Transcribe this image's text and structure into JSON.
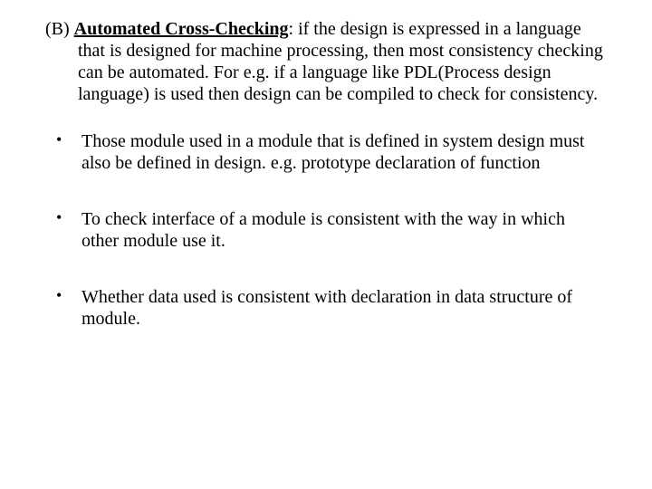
{
  "section": {
    "label": "(B) ",
    "heading": "Automated Cross-Checking",
    "body": ": if the design is expressed in a language that is designed for machine processing, then most consistency checking can be automated. For e.g. if a language like PDL(Process design language) is used then design can be compiled to check for consistency."
  },
  "bullets": [
    {
      "text": "Those module used in a module that is defined in system design must also be defined in design. e.g. prototype declaration of function"
    },
    {
      "text": "To check interface of a module is consistent with the way in which other module use it."
    },
    {
      "text": "Whether data used is consistent with declaration in data structure of module."
    }
  ]
}
